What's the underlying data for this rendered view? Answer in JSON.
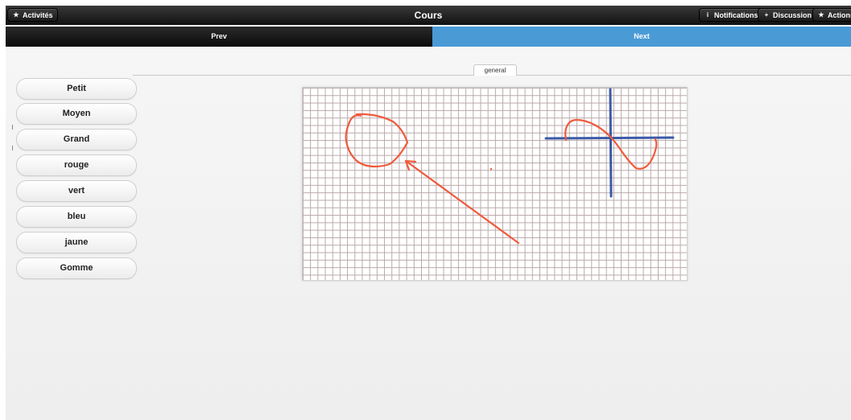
{
  "topbar": {
    "activities_label": "Activités",
    "activities_icon": "star-icon",
    "title": "Cours",
    "notifications_label": "Notifications",
    "notifications_icon": "info-icon",
    "discussion_label": "Discussion",
    "discussion_icon": "plus-icon",
    "actions_label": "Actions",
    "actions_icon": "star-icon"
  },
  "navbar": {
    "prev_label": "Prev",
    "next_label": "Next",
    "next_color": "#4a9ad6"
  },
  "tabs": [
    {
      "label": "general",
      "active": true
    }
  ],
  "tools": [
    {
      "label": "Petit"
    },
    {
      "label": "Moyen"
    },
    {
      "label": "Grand"
    },
    {
      "label": "rouge"
    },
    {
      "label": "vert"
    },
    {
      "label": "bleu"
    },
    {
      "label": "jaune"
    },
    {
      "label": "Gomme"
    }
  ],
  "drawing": {
    "stroke_colors": {
      "red": "#ef5a3c",
      "blue": "#3a5aa8"
    },
    "grid_color": "#b9a9a9"
  }
}
